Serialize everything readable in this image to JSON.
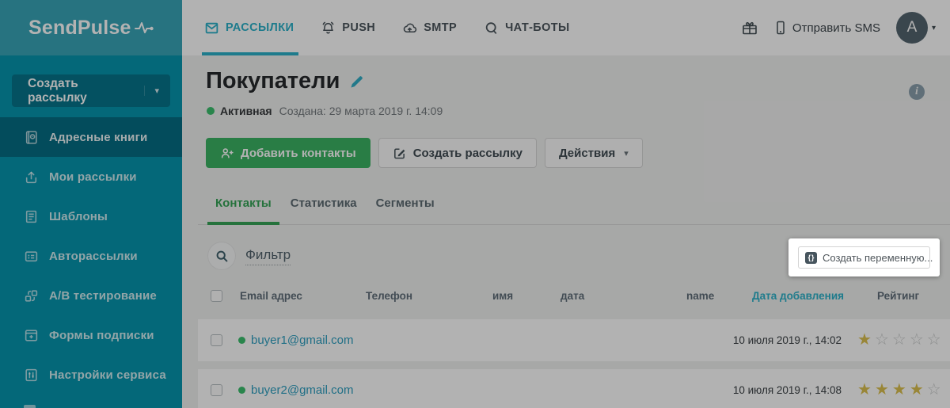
{
  "brand": {
    "logo_text": "SendPulse"
  },
  "colors": {
    "sidebar_teal": "#0795ae",
    "accent_teal": "#2bb1c9",
    "primary_green": "#3cb364",
    "tab_green": "#35a457",
    "star_gold": "#dcc14f",
    "link_teal": "#2e9fc0"
  },
  "sidebar": {
    "create_button_label": "Создать рассылку",
    "items": [
      {
        "label": "Адресные книги",
        "icon": "address-book-icon",
        "active": true
      },
      {
        "label": "Мои рассылки",
        "icon": "my-campaigns-icon",
        "active": false
      },
      {
        "label": "Шаблоны",
        "icon": "templates-icon",
        "active": false
      },
      {
        "label": "Авторассылки",
        "icon": "autoresponders-icon",
        "active": false
      },
      {
        "label": "A/B тестирование",
        "icon": "ab-testing-icon",
        "active": false
      },
      {
        "label": "Формы подписки",
        "icon": "subscription-forms-icon",
        "active": false
      },
      {
        "label": "Настройки сервиса",
        "icon": "service-settings-icon",
        "active": false
      }
    ]
  },
  "topnav": {
    "items": [
      {
        "label": "РАССЫЛКИ",
        "icon": "envelope-icon",
        "active": true
      },
      {
        "label": "PUSH",
        "icon": "bell-icon",
        "active": false
      },
      {
        "label": "SMTP",
        "icon": "cloud-upload-icon",
        "active": false
      },
      {
        "label": "ЧАТ-БОТЫ",
        "icon": "chat-bubble-icon",
        "active": false
      }
    ],
    "send_sms_label": "Отправить SMS",
    "avatar_letter": "A"
  },
  "page": {
    "title": "Покупатели",
    "status_label": "Активная",
    "created_label": "Создана: 29 марта 2019 г. 14:09",
    "add_contacts_label": "Добавить контакты",
    "create_campaign_label": "Создать рассылку",
    "actions_label": "Действия",
    "tabs": [
      {
        "label": "Контакты",
        "active": true
      },
      {
        "label": "Статистика",
        "active": false
      },
      {
        "label": "Сегменты",
        "active": false
      }
    ],
    "filter_label": "Фильтр",
    "create_variable_label": "Создать переменную..."
  },
  "table": {
    "stars_total": 5,
    "headers": {
      "email": "Email адрес",
      "phone": "Телефон",
      "name_ru": "имя",
      "date_ru": "дата",
      "name_en": "name",
      "date_added": "Дата добавления",
      "rating": "Рейтинг"
    },
    "sorted_column": "Дата добавления",
    "rows": [
      {
        "email": "buyer1@gmail.com",
        "status": "active",
        "date_added": "10 июля 2019 г., 14:02",
        "rating": 1
      },
      {
        "email": "buyer2@gmail.com",
        "status": "active",
        "date_added": "10 июля 2019 г., 14:08",
        "rating": 4
      }
    ]
  }
}
